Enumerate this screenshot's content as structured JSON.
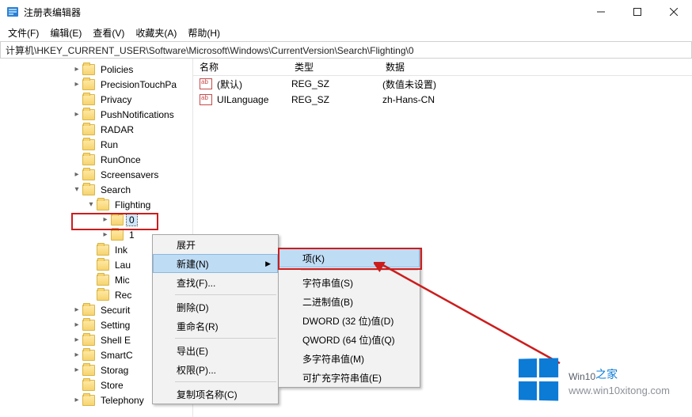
{
  "title": "注册表编辑器",
  "window": {
    "min": "–",
    "max": "☐",
    "close": "✕"
  },
  "menu": {
    "file": "文件(F)",
    "edit": "编辑(E)",
    "view": "查看(V)",
    "fav": "收藏夹(A)",
    "help": "帮助(H)"
  },
  "address": "计算机\\HKEY_CURRENT_USER\\Software\\Microsoft\\Windows\\CurrentVersion\\Search\\Flighting\\0",
  "columns": {
    "name": "名称",
    "type": "类型",
    "data": "数据"
  },
  "values": [
    {
      "name": "(默认)",
      "type": "REG_SZ",
      "data": "(数值未设置)"
    },
    {
      "name": "UILanguage",
      "type": "REG_SZ",
      "data": "zh-Hans-CN"
    }
  ],
  "tree": {
    "policies": "Policies",
    "precision": "PrecisionTouchPa",
    "privacy": "Privacy",
    "push": "PushNotifications",
    "radar": "RADAR",
    "run": "Run",
    "runonce": "RunOnce",
    "screensavers": "Screensavers",
    "search": "Search",
    "flighting": "Flighting",
    "zero": "0",
    "one": "1",
    "ink": "Ink",
    "laun": "Lau",
    "mic": "Mic",
    "rec": "Rec",
    "security": "Securit",
    "setting": "Setting",
    "shell": "Shell E",
    "smart": "SmartC",
    "storag": "Storag",
    "store": "Store",
    "telephony": "Telephony"
  },
  "ctx1": {
    "expand": "展开",
    "new": "新建(N)",
    "find": "查找(F)...",
    "delete": "删除(D)",
    "rename": "重命名(R)",
    "export": "导出(E)",
    "perm": "权限(P)...",
    "copy": "复制项名称(C)"
  },
  "ctx2": {
    "key": "项(K)",
    "string": "字符串值(S)",
    "binary": "二进制值(B)",
    "dword": "DWORD (32 位)值(D)",
    "qword": "QWORD (64 位)值(Q)",
    "multi": "多字符串值(M)",
    "expand": "可扩充字符串值(E)"
  },
  "watermark": {
    "brand": "Win10",
    "suffix": "之家",
    "url": "www.win10xitong.com"
  }
}
